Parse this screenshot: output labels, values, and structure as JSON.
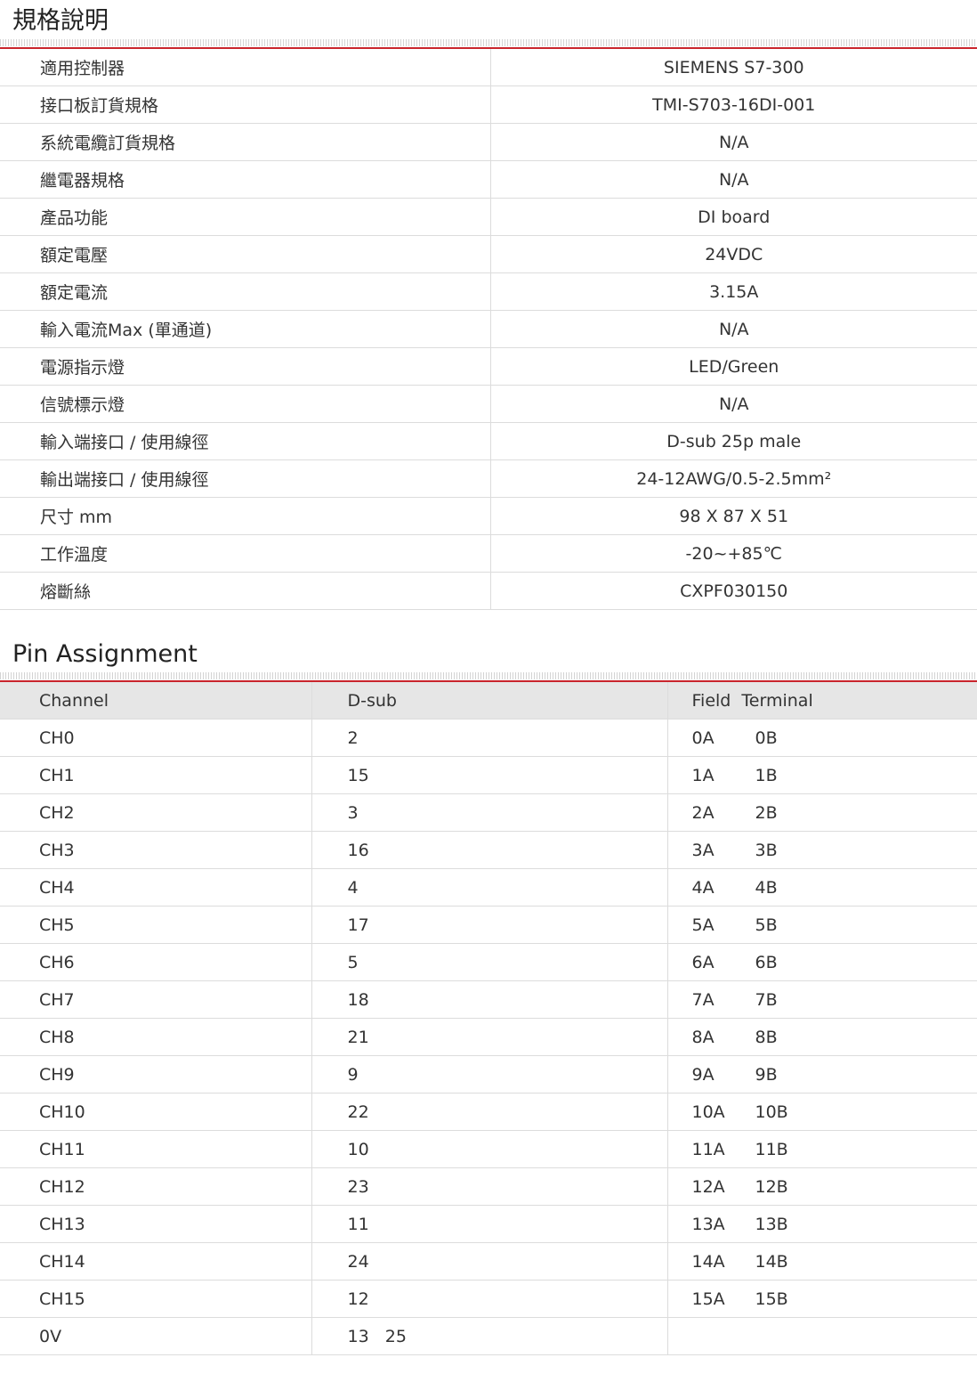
{
  "spec_section": {
    "title": "規格說明",
    "rows": [
      {
        "label": "適用控制器",
        "value": "SIEMENS S7-300"
      },
      {
        "label": "接口板訂貨規格",
        "value": "TMI-S703-16DI-001"
      },
      {
        "label": "系統電纜訂貨規格",
        "value": "N/A"
      },
      {
        "label": "繼電器規格",
        "value": "N/A"
      },
      {
        "label": "產品功能",
        "value": "DI board"
      },
      {
        "label": "額定電壓",
        "value": "24VDC"
      },
      {
        "label": "額定電流",
        "value": "3.15A"
      },
      {
        "label": "輸入電流Max (單通道)",
        "value": "N/A"
      },
      {
        "label": "電源指示燈",
        "value": "LED/Green"
      },
      {
        "label": "信號標示燈",
        "value": "N/A"
      },
      {
        "label": "輸入端接口 / 使用線徑",
        "value": "D-sub 25p male"
      },
      {
        "label": "輸出端接口 / 使用線徑",
        "value": "24-12AWG/0.5-2.5mm²"
      },
      {
        "label": "尺寸 mm",
        "value": "98 X 87 X 51"
      },
      {
        "label": "工作溫度",
        "value": "-20~+85℃"
      },
      {
        "label": "熔斷絲",
        "value": "CXPF030150"
      }
    ]
  },
  "pin_section": {
    "title": "Pin Assignment",
    "headers": {
      "channel": "Channel",
      "dsub": "D-sub",
      "terminal": "Field  Terminal"
    },
    "rows": [
      {
        "channel": "CH0",
        "dsub": "2",
        "term_a": "0A",
        "term_b": "0B"
      },
      {
        "channel": "CH1",
        "dsub": "15",
        "term_a": "1A",
        "term_b": "1B"
      },
      {
        "channel": "CH2",
        "dsub": "3",
        "term_a": "2A",
        "term_b": "2B"
      },
      {
        "channel": "CH3",
        "dsub": "16",
        "term_a": "3A",
        "term_b": "3B"
      },
      {
        "channel": "CH4",
        "dsub": "4",
        "term_a": "4A",
        "term_b": "4B"
      },
      {
        "channel": "CH5",
        "dsub": "17",
        "term_a": "5A",
        "term_b": "5B"
      },
      {
        "channel": "CH6",
        "dsub": "5",
        "term_a": "6A",
        "term_b": "6B"
      },
      {
        "channel": "CH7",
        "dsub": "18",
        "term_a": "7A",
        "term_b": "7B"
      },
      {
        "channel": "CH8",
        "dsub": "21",
        "term_a": "8A",
        "term_b": "8B"
      },
      {
        "channel": "CH9",
        "dsub": "9",
        "term_a": "9A",
        "term_b": "9B"
      },
      {
        "channel": "CH10",
        "dsub": "22",
        "term_a": "10A",
        "term_b": "10B"
      },
      {
        "channel": "CH11",
        "dsub": "10",
        "term_a": "11A",
        "term_b": "11B"
      },
      {
        "channel": "CH12",
        "dsub": "23",
        "term_a": "12A",
        "term_b": "12B"
      },
      {
        "channel": "CH13",
        "dsub": "11",
        "term_a": "13A",
        "term_b": "13B"
      },
      {
        "channel": "CH14",
        "dsub": "24",
        "term_a": "14A",
        "term_b": "14B"
      },
      {
        "channel": "CH15",
        "dsub": "12",
        "term_a": "15A",
        "term_b": "15B"
      },
      {
        "channel": "0V",
        "dsub": "13   25",
        "term_a": "",
        "term_b": ""
      }
    ]
  },
  "colors": {
    "accent_line": "#c9252c",
    "header_background": "#e6e6e6",
    "row_divider": "#dcdcdc"
  }
}
